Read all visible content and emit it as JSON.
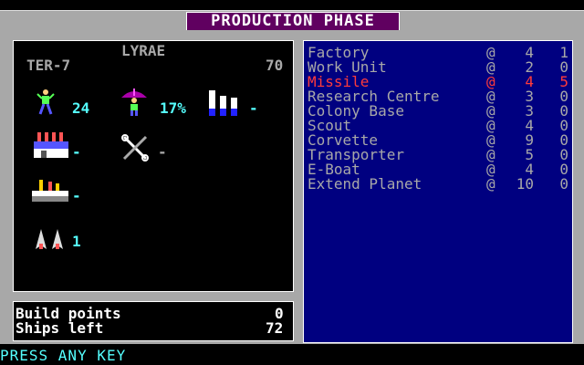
{
  "screen": {
    "title": "PRODUCTION PHASE"
  },
  "planet": {
    "name": "LYRAE",
    "sector": "TER-7",
    "value": "70",
    "population": "24",
    "tax_rate": "17%",
    "factories": "-",
    "tools": "-",
    "industry": "-",
    "ships": "1",
    "research_bar": "-"
  },
  "production": [
    {
      "name": "Factory",
      "at": "@",
      "cost": "4",
      "qty": "1"
    },
    {
      "name": "Work Unit",
      "at": "@",
      "cost": "2",
      "qty": "0"
    },
    {
      "name": "Missile",
      "at": "@",
      "cost": "4",
      "qty": "5",
      "highlight": true
    },
    {
      "name": "Research Centre",
      "at": "@",
      "cost": "3",
      "qty": "0"
    },
    {
      "name": "Colony Base",
      "at": "@",
      "cost": "3",
      "qty": "0"
    },
    {
      "name": "Scout",
      "at": "@",
      "cost": "4",
      "qty": "0"
    },
    {
      "name": "Corvette",
      "at": "@",
      "cost": "9",
      "qty": "0"
    },
    {
      "name": "Transporter",
      "at": "@",
      "cost": "5",
      "qty": "0"
    },
    {
      "name": "E-Boat",
      "at": "@",
      "cost": "4",
      "qty": "0"
    },
    {
      "name": "Extend Planet",
      "at": "@",
      "cost": "10",
      "qty": "0"
    }
  ],
  "stats": {
    "build_points_label": "Build points",
    "build_points_value": "0",
    "ships_left_label": "Ships left",
    "ships_left_value": "72"
  },
  "prompt": "PRESS ANY KEY",
  "colors": {
    "frame": "#a8a8a8",
    "title_bg": "#600060",
    "list_bg": "#000080",
    "highlight": "#ff3b3b",
    "accent": "#55ffff"
  }
}
